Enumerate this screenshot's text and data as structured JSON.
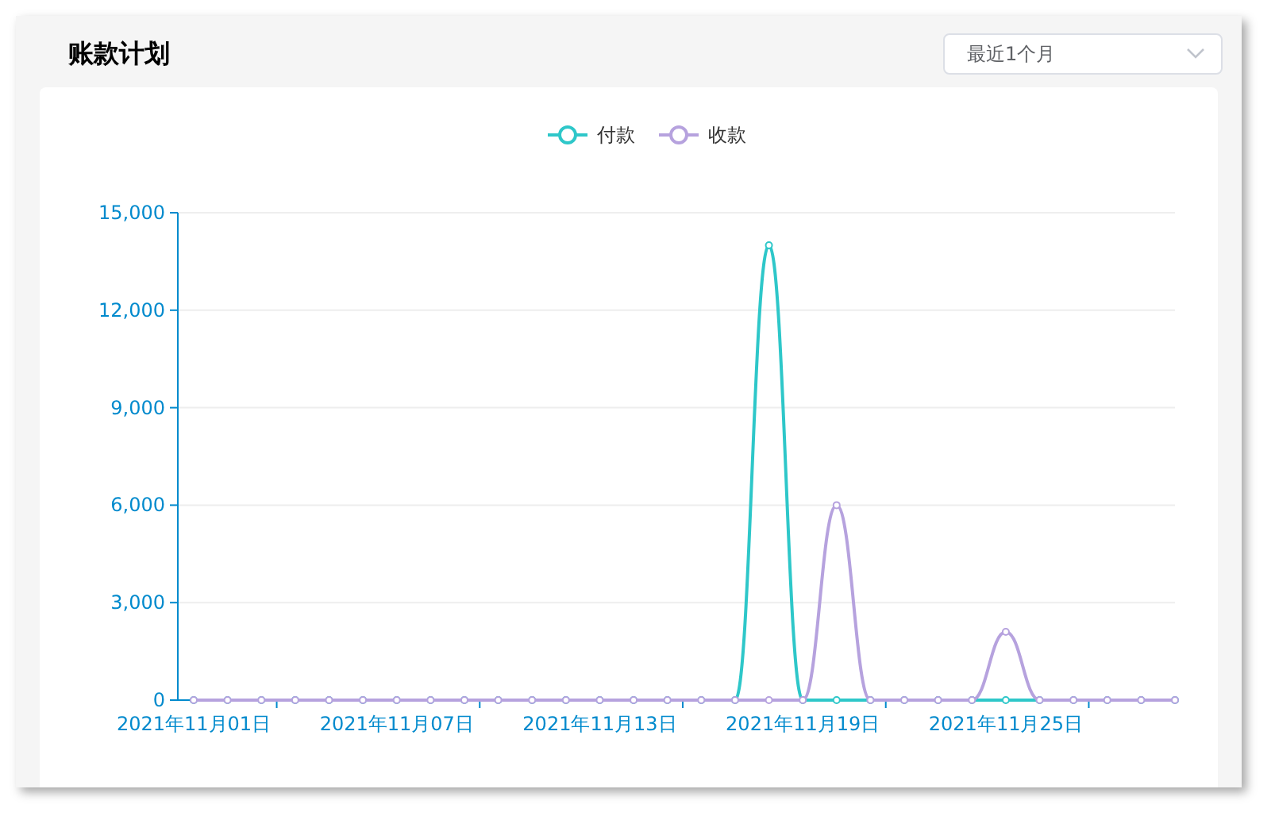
{
  "title": "账款计划",
  "period_select": {
    "value": "最近1个月"
  },
  "chart_data": {
    "type": "line",
    "categories": [
      "2021年11月01日",
      null,
      null,
      null,
      null,
      null,
      "2021年11月07日",
      null,
      null,
      null,
      null,
      null,
      "2021年11月13日",
      null,
      null,
      null,
      null,
      null,
      "2021年11月19日",
      null,
      null,
      null,
      null,
      null,
      "2021年11月25日",
      null,
      null,
      null,
      null,
      null
    ],
    "ylim": [
      0,
      15000
    ],
    "yticks": [
      {
        "value": 0,
        "label": "0"
      },
      {
        "value": 3000,
        "label": "3,000"
      },
      {
        "value": 6000,
        "label": "6,000"
      },
      {
        "value": 9000,
        "label": "9,000"
      },
      {
        "value": 12000,
        "label": "12,000"
      },
      {
        "value": 15000,
        "label": "15,000"
      }
    ],
    "grid": true,
    "legend": true,
    "series": [
      {
        "name": "付款",
        "color": "#2ec7c9",
        "marker": "circle",
        "values": [
          0,
          0,
          0,
          0,
          0,
          0,
          0,
          0,
          0,
          0,
          0,
          0,
          0,
          0,
          0,
          0,
          0,
          14000,
          0,
          0,
          0,
          0,
          0,
          0,
          0,
          0,
          0,
          0,
          0,
          0
        ]
      },
      {
        "name": "收款",
        "color": "#b6a2de",
        "marker": "circle",
        "values": [
          0,
          0,
          0,
          0,
          0,
          0,
          0,
          0,
          0,
          0,
          0,
          0,
          0,
          0,
          0,
          0,
          0,
          0,
          0,
          6000,
          0,
          0,
          0,
          0,
          2100,
          0,
          0,
          0,
          0,
          0
        ]
      }
    ]
  }
}
